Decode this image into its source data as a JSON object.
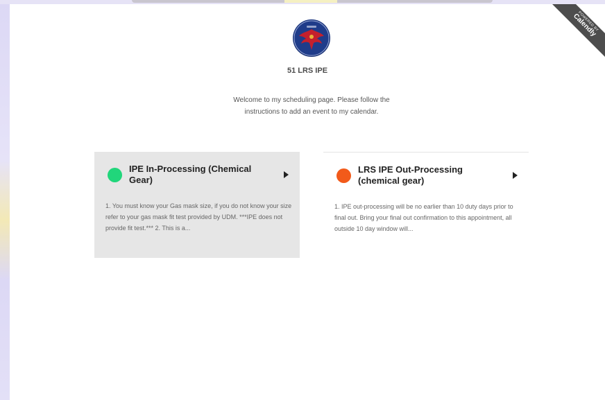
{
  "badge": {
    "line1": "POWERED BY",
    "line2": "Calendly"
  },
  "header": {
    "org_name": "51 LRS IPE",
    "welcome": "Welcome to my scheduling page. Please follow the instructions to add an event to my calendar."
  },
  "events": [
    {
      "title": "IPE In-Processing (Chemical Gear)",
      "color": "#21d67b",
      "description": "1. You must know your Gas mask size, if you do not know your size refer to your gas mask fit test provided by UDM. ***IPE does not provide fit test.*** 2. This is a..."
    },
    {
      "title": "LRS IPE Out-Processing (chemical gear)",
      "color": "#f25a1a",
      "description": "1. IPE out-processing will be no earlier than 10 duty days prior to final out. Bring your final out confirmation to this appointment, all outside 10 day window will..."
    }
  ],
  "icons": {
    "logo": "squadron-emblem-icon",
    "arrow": "triangle-right-icon"
  }
}
